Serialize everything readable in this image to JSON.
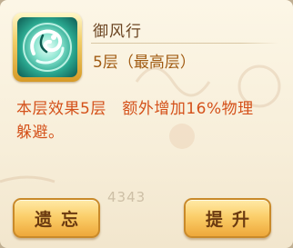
{
  "skill": {
    "name": "御风行",
    "level_text": "5层（最高层）",
    "icon": "wind-swirl-icon"
  },
  "effect": {
    "line1": "本层效果5层　额外增加16%物理",
    "line2": "躲避。"
  },
  "background": {
    "faded_number": "4343"
  },
  "buttons": {
    "forget_label": "遗忘",
    "upgrade_label": "提升"
  },
  "colors": {
    "title": "#6a4320",
    "level": "#a15c14",
    "effect": "#d4511a",
    "button_text": "#6b3a10"
  }
}
